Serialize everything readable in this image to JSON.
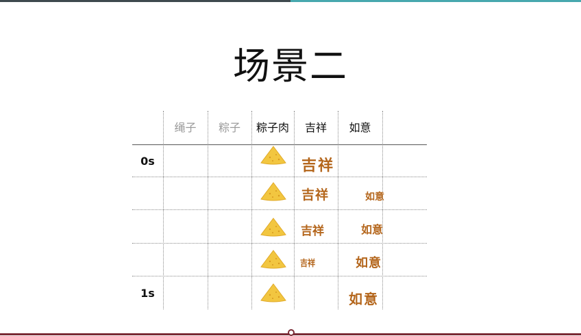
{
  "slide": {
    "title": "场景二"
  },
  "table": {
    "columns": [
      "绳子",
      "粽子",
      "粽子肉",
      "吉祥",
      "如意"
    ],
    "rows": [
      {
        "time": "0s",
        "jixiang": "吉祥",
        "ruyi": ""
      },
      {
        "time": "",
        "jixiang": "吉祥",
        "ruyi": "如意"
      },
      {
        "time": "",
        "jixiang": "吉祥",
        "ruyi": "如意"
      },
      {
        "time": "",
        "jixiang": "吉祥",
        "ruyi": "如意"
      },
      {
        "time": "1s",
        "jixiang": "",
        "ruyi": "如意"
      }
    ]
  },
  "colors": {
    "header_dim": "#9b9b9b",
    "blessing_text": "#b4661c",
    "zongzi_fill": "#f2c640",
    "top_bar_left": "#3f4a4e",
    "top_bar_right": "#47a8ae",
    "bottom_bar": "#7a2a34"
  },
  "icons": {
    "zongzi": "zongzi-icon"
  }
}
